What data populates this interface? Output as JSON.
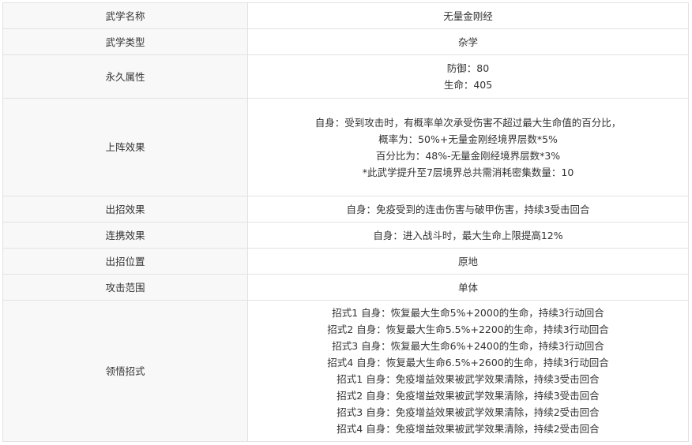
{
  "rows": [
    {
      "label": "武学名称",
      "lines": [
        "无量金刚经"
      ]
    },
    {
      "label": "武学类型",
      "lines": [
        "杂学"
      ]
    },
    {
      "label": "永久属性",
      "lines": [
        "防御：80",
        "生命：405"
      ]
    },
    {
      "label": "上阵效果",
      "lines": [
        "自身：受到攻击时，有概率单次承受伤害不超过最大生命值的百分比，",
        "概率为：50%+无量金刚经境界层数*5%",
        "百分比为：48%-无量金刚经境界层数*3%",
        "*此武学提升至7层境界总共需消耗密集数量：10"
      ]
    },
    {
      "label": "出招效果",
      "lines": [
        "自身：免疫受到的连击伤害与破甲伤害，持续3受击回合"
      ]
    },
    {
      "label": "连携效果",
      "lines": [
        "自身：进入战斗时，最大生命上限提高12%"
      ]
    },
    {
      "label": "出招位置",
      "lines": [
        "原地"
      ]
    },
    {
      "label": "攻击范围",
      "lines": [
        "单体"
      ]
    },
    {
      "label": "领悟招式",
      "lines": [
        "招式1 自身：恢复最大生命5%+2000的生命，持续3行动回合",
        "招式2 自身：恢复最大生命5.5%+2200的生命，持续3行动回合",
        "招式3 自身：恢复最大生命6%+2400的生命，持续3行动回合",
        "招式4 自身：恢复最大生命6.5%+2600的生命，持续3行动回合",
        "招式1 自身：免疫增益效果被武学效果清除，持续3受击回合",
        "招式2 自身：免疫增益效果被武学效果清除，持续3受击回合",
        "招式3 自身：免疫增益效果被武学效果清除，持续2受击回合",
        "招式4 自身：免疫增益效果被武学效果清除，持续2受击回合"
      ]
    }
  ]
}
